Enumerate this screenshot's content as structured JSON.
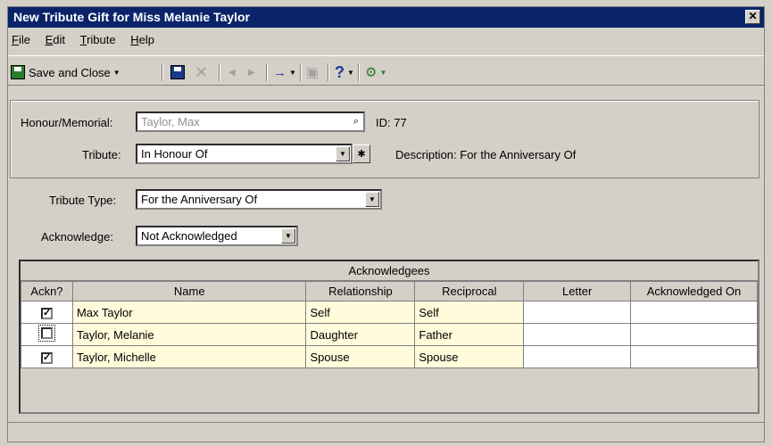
{
  "window": {
    "title": "New Tribute Gift for Miss Melanie Taylor",
    "close_glyph": "✕"
  },
  "menu": [
    {
      "label": "File"
    },
    {
      "label": "Edit"
    },
    {
      "label": "Tribute"
    },
    {
      "label": "Help"
    }
  ],
  "toolbar": {
    "save_close_label": "Save and Close"
  },
  "form": {
    "honour_label": "Honour/Memorial:",
    "honour_value": "Taylor, Max",
    "id_text": "ID:  77",
    "tribute_label": "Tribute:",
    "tribute_value": "In Honour Of",
    "description_text": "Description: For the Anniversary Of",
    "tribute_type_label": "Tribute Type:",
    "tribute_type_value": "For the Anniversary Of",
    "acknowledge_label": "Acknowledge:",
    "acknowledge_value": "Not Acknowledged"
  },
  "grid": {
    "title": "Acknowledgees",
    "columns": [
      "Ackn?",
      "Name",
      "Relationship",
      "Reciprocal",
      "Letter",
      "Acknowledged On"
    ],
    "rows": [
      {
        "ackn": true,
        "name": "Max Taylor",
        "relationship": "Self",
        "reciprocal": "Self",
        "letter": "",
        "acknowledged_on": ""
      },
      {
        "ackn": false,
        "name": "Taylor, Melanie",
        "relationship": "Daughter",
        "reciprocal": "Father",
        "letter": "",
        "acknowledged_on": ""
      },
      {
        "ackn": true,
        "name": "Taylor, Michelle",
        "relationship": "Spouse",
        "reciprocal": "Spouse",
        "letter": "",
        "acknowledged_on": ""
      }
    ]
  },
  "colors": {
    "titlebar": "#0a246a",
    "row_highlight": "#fffbdb",
    "face": "#d4d0c8"
  }
}
